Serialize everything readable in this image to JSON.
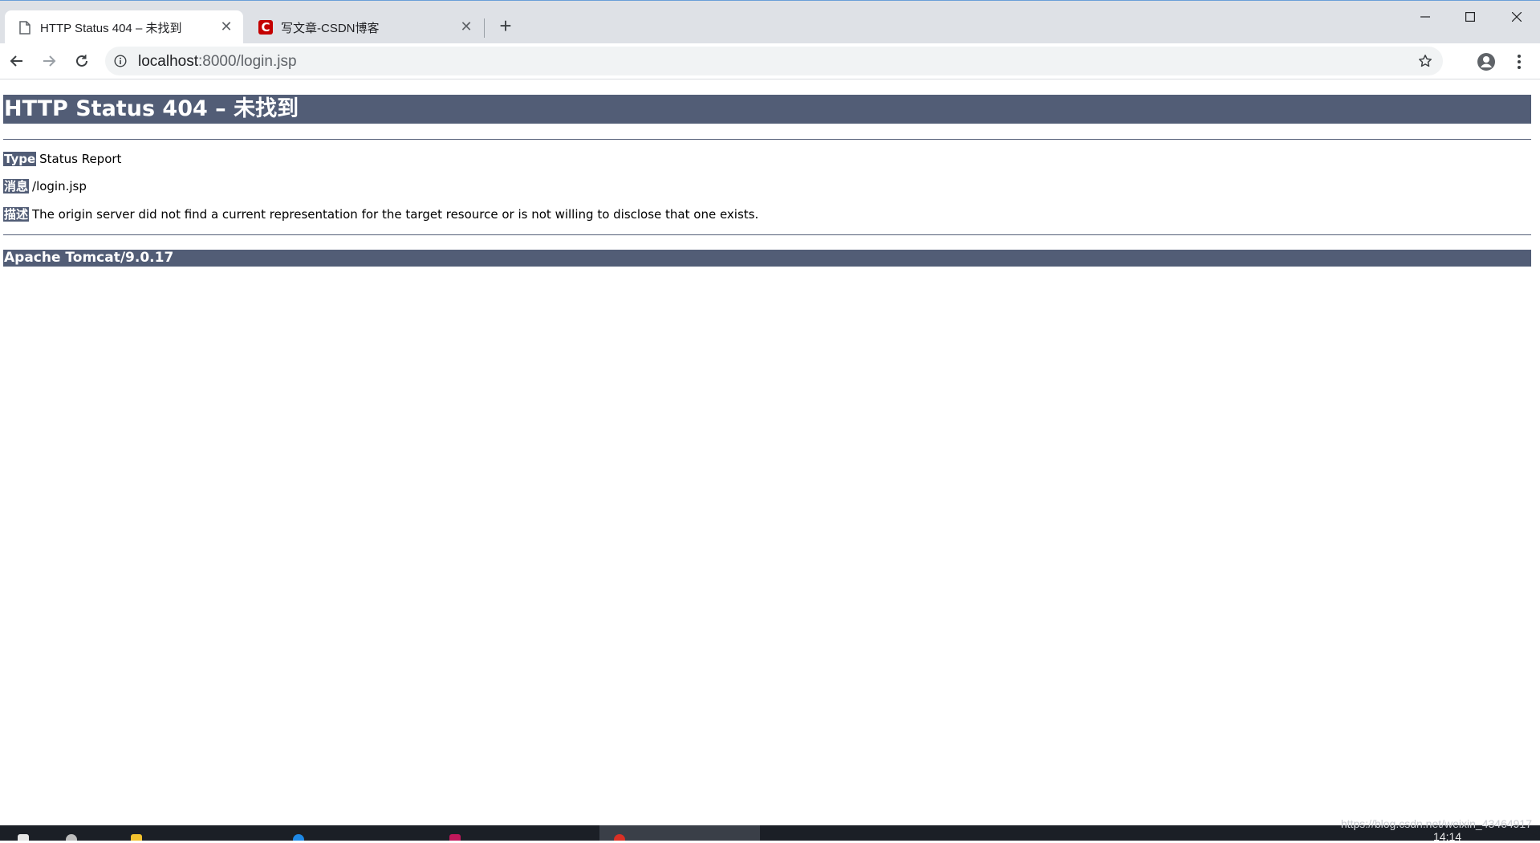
{
  "browser": {
    "tabs": [
      {
        "title": "HTTP Status 404 – 未找到",
        "icon": "document-icon",
        "active": true
      },
      {
        "title": "写文章-CSDN博客",
        "icon": "csdn-logo-icon",
        "favicon_letter": "C",
        "active": false
      }
    ],
    "address": {
      "host": "localhost",
      "path": ":8000/login.jsp"
    }
  },
  "page": {
    "heading": "HTTP Status 404 – 未找到",
    "type_label": "Type",
    "type_value": "Status Report",
    "message_label": "消息",
    "message_value": "/login.jsp",
    "description_label": "描述",
    "description_value": "The origin server did not find a current representation for the target resource or is not willing to disclose that one exists.",
    "footer": "Apache Tomcat/9.0.17",
    "accent_color": "#525d76"
  },
  "taskbar": {
    "clock": "14:14",
    "watermark": "https://blog.csdn.net/weixin_43464917"
  }
}
